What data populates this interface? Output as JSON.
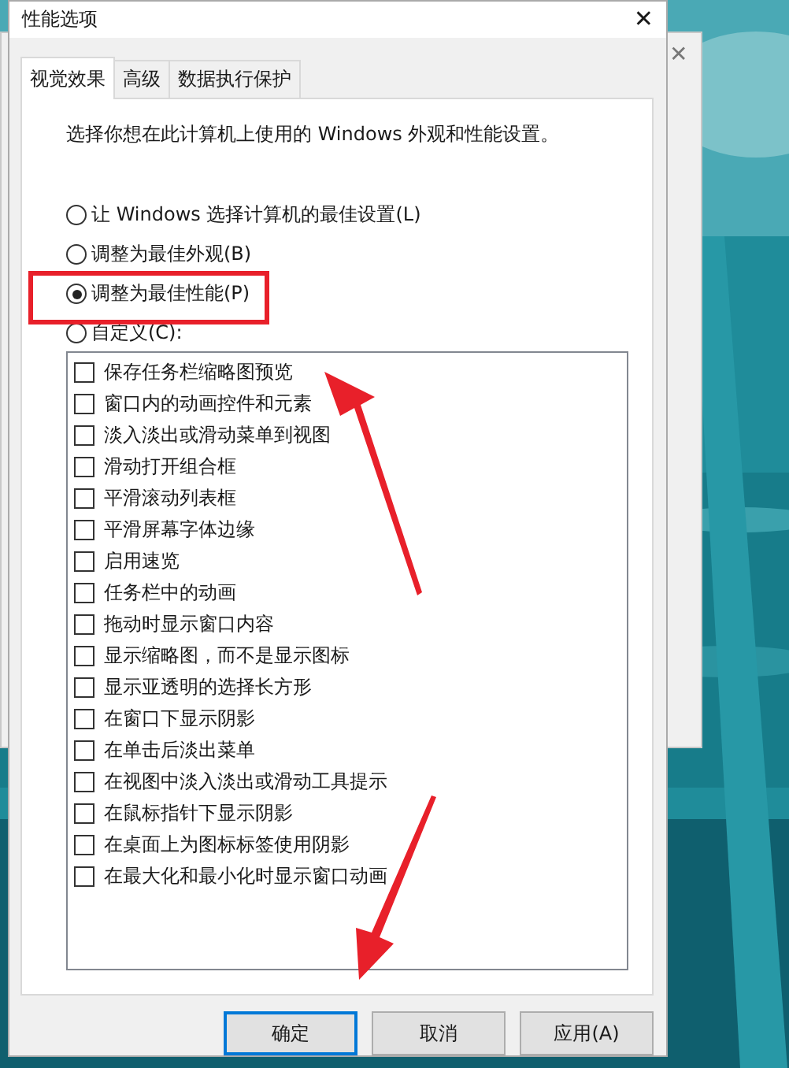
{
  "window": {
    "title": "性能选项",
    "close": "✕"
  },
  "back_window": {
    "close": "✕"
  },
  "tabs": [
    {
      "label": "视觉效果",
      "selected": true
    },
    {
      "label": "高级",
      "selected": false
    },
    {
      "label": "数据执行保护",
      "selected": false
    }
  ],
  "description": "选择你想在此计算机上使用的 Windows 外观和性能设置。",
  "options": [
    {
      "label": "让 Windows 选择计算机的最佳设置(L)",
      "selected": false
    },
    {
      "label": "调整为最佳外观(B)",
      "selected": false
    },
    {
      "label": "调整为最佳性能(P)",
      "selected": true
    },
    {
      "label": "自定义(C):",
      "selected": false
    }
  ],
  "effects": [
    {
      "label": "保存任务栏缩略图预览",
      "checked": false
    },
    {
      "label": "窗口内的动画控件和元素",
      "checked": false
    },
    {
      "label": "淡入淡出或滑动菜单到视图",
      "checked": false
    },
    {
      "label": "滑动打开组合框",
      "checked": false
    },
    {
      "label": "平滑滚动列表框",
      "checked": false
    },
    {
      "label": "平滑屏幕字体边缘",
      "checked": false
    },
    {
      "label": "启用速览",
      "checked": false
    },
    {
      "label": "任务栏中的动画",
      "checked": false
    },
    {
      "label": "拖动时显示窗口内容",
      "checked": false
    },
    {
      "label": "显示缩略图，而不是显示图标",
      "checked": false
    },
    {
      "label": "显示亚透明的选择长方形",
      "checked": false
    },
    {
      "label": "在窗口下显示阴影",
      "checked": false
    },
    {
      "label": "在单击后淡出菜单",
      "checked": false
    },
    {
      "label": "在视图中淡入淡出或滑动工具提示",
      "checked": false
    },
    {
      "label": "在鼠标指针下显示阴影",
      "checked": false
    },
    {
      "label": "在桌面上为图标标签使用阴影",
      "checked": false
    },
    {
      "label": "在最大化和最小化时显示窗口动画",
      "checked": false
    }
  ],
  "buttons": [
    {
      "label": "确定",
      "default": true
    },
    {
      "label": "取消",
      "default": false
    },
    {
      "label": "应用(A)",
      "default": false
    }
  ]
}
